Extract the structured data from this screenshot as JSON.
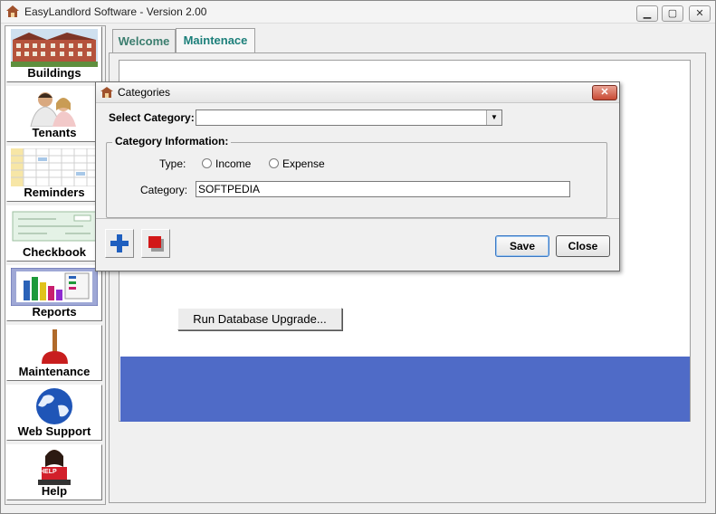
{
  "window": {
    "title": "EasyLandlord Software - Version 2.00",
    "minimize_glyph": "▁",
    "maximize_glyph": "▢",
    "close_glyph": "✕"
  },
  "sidebar": {
    "items": [
      {
        "label": "Buildings",
        "icon": "buildings-icon"
      },
      {
        "label": "Tenants",
        "icon": "tenants-icon"
      },
      {
        "label": "Reminders",
        "icon": "calendar-icon"
      },
      {
        "label": "Checkbook",
        "icon": "check-icon"
      },
      {
        "label": "Reports",
        "icon": "bar-chart-icon"
      },
      {
        "label": "Maintenance",
        "icon": "plunger-icon"
      },
      {
        "label": "Web Support",
        "icon": "globe-icon"
      },
      {
        "label": "Help",
        "icon": "help-person-icon"
      }
    ],
    "help_sign": "HELP"
  },
  "tabs": [
    {
      "label": "Welcome"
    },
    {
      "label": "Maintenace"
    }
  ],
  "main": {
    "upgrade_button": "Run Database Upgrade...",
    "band_color": "#4f6bc7"
  },
  "dialog": {
    "title": "Categories",
    "close_glyph": "✕",
    "select_category_label": "Select Category:",
    "select_category_value": "",
    "group_title": "Category Information:",
    "type_label": "Type:",
    "type_options": [
      "Income",
      "Expense"
    ],
    "category_label": "Category:",
    "category_value": "SOFTPEDIA",
    "save_button": "Save",
    "close_button": "Close"
  }
}
